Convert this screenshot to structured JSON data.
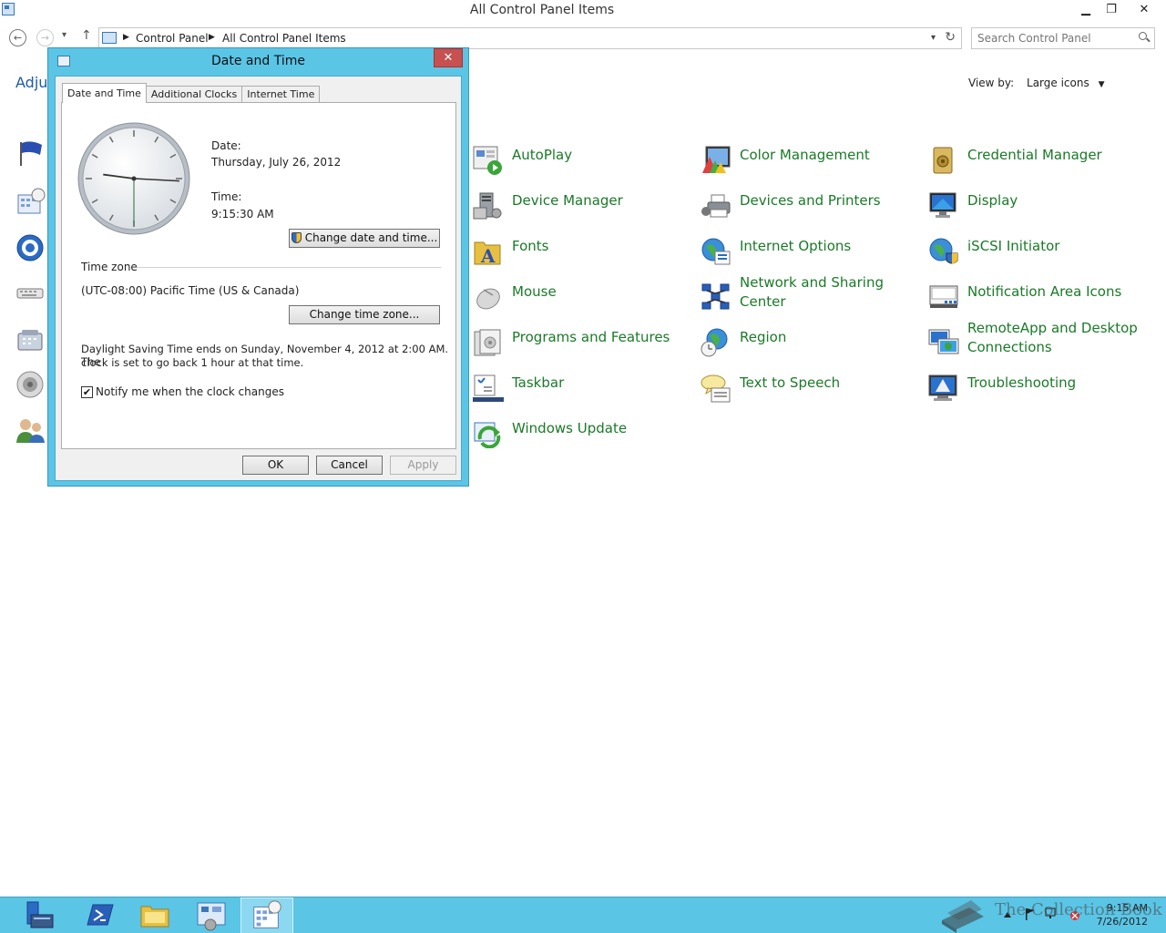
{
  "window": {
    "title": "All Control Panel Items",
    "minimize": "▁",
    "restore": "❐",
    "close": "✕"
  },
  "nav": {
    "back": "←",
    "forward": "→",
    "recent": "▾",
    "up": "↑",
    "breadcrumb": [
      "Control Panel",
      "All Control Panel Items"
    ],
    "separator": "▶",
    "dropdown": "▾",
    "refresh": "↻",
    "search_placeholder": "Search Control Panel"
  },
  "content": {
    "heading_partial": "Adjus",
    "view_by_label": "View by:",
    "view_by_value": "Large icons",
    "view_by_caret": "▼",
    "items": [
      {
        "label": "AutoPlay",
        "icon": "autoplay-icon"
      },
      {
        "label": "Color Management",
        "icon": "color-management-icon"
      },
      {
        "label": "Credential Manager",
        "icon": "credential-manager-icon"
      },
      {
        "label": "Device Manager",
        "icon": "device-manager-icon"
      },
      {
        "label": "Devices and Printers",
        "icon": "devices-printers-icon"
      },
      {
        "label": "Display",
        "icon": "display-icon"
      },
      {
        "label": "Fonts",
        "icon": "fonts-icon"
      },
      {
        "label": "Internet Options",
        "icon": "internet-options-icon"
      },
      {
        "label": "iSCSI Initiator",
        "icon": "iscsi-icon"
      },
      {
        "label": "Mouse",
        "icon": "mouse-icon"
      },
      {
        "label": "Network and Sharing",
        "label2": "Center",
        "icon": "network-icon"
      },
      {
        "label": "Notification Area Icons",
        "icon": "notification-icon"
      },
      {
        "label": "Programs and Features",
        "icon": "programs-icon"
      },
      {
        "label": "Region",
        "icon": "region-icon"
      },
      {
        "label": "RemoteApp and Desktop",
        "label2": "Connections",
        "icon": "remoteapp-icon"
      },
      {
        "label": "Taskbar",
        "icon": "taskbar-icon"
      },
      {
        "label": "Text to Speech",
        "icon": "text-to-speech-icon"
      },
      {
        "label": "Troubleshooting",
        "icon": "troubleshooting-icon"
      },
      {
        "label": "Windows Update",
        "icon": "windows-update-icon"
      }
    ]
  },
  "dialog": {
    "title": "Date and Time",
    "close": "✕",
    "tabs": [
      "Date and Time",
      "Additional Clocks",
      "Internet Time"
    ],
    "date_label": "Date:",
    "date_value": "Thursday, July 26, 2012",
    "time_label": "Time:",
    "time_value": "9:15:30 AM",
    "change_datetime": "Change date and time...",
    "timezone_group": "Time zone",
    "timezone_value": "(UTC-08:00) Pacific Time (US & Canada)",
    "change_timezone": "Change time zone...",
    "dst_line1": "Daylight Saving Time ends on Sunday, November 4, 2012 at 2:00 AM. The",
    "dst_line2": "clock is set to go back 1 hour at that time.",
    "notify_label": "Notify me when the clock changes",
    "notify_check": "✔",
    "ok": "OK",
    "cancel": "Cancel",
    "apply": "Apply",
    "clock_time": {
      "hour": 9,
      "minute": 15,
      "second": 30
    }
  },
  "taskbar": {
    "time": "9:15 AM",
    "date": "7/26/2012",
    "watermark": "The Collection Book"
  }
}
